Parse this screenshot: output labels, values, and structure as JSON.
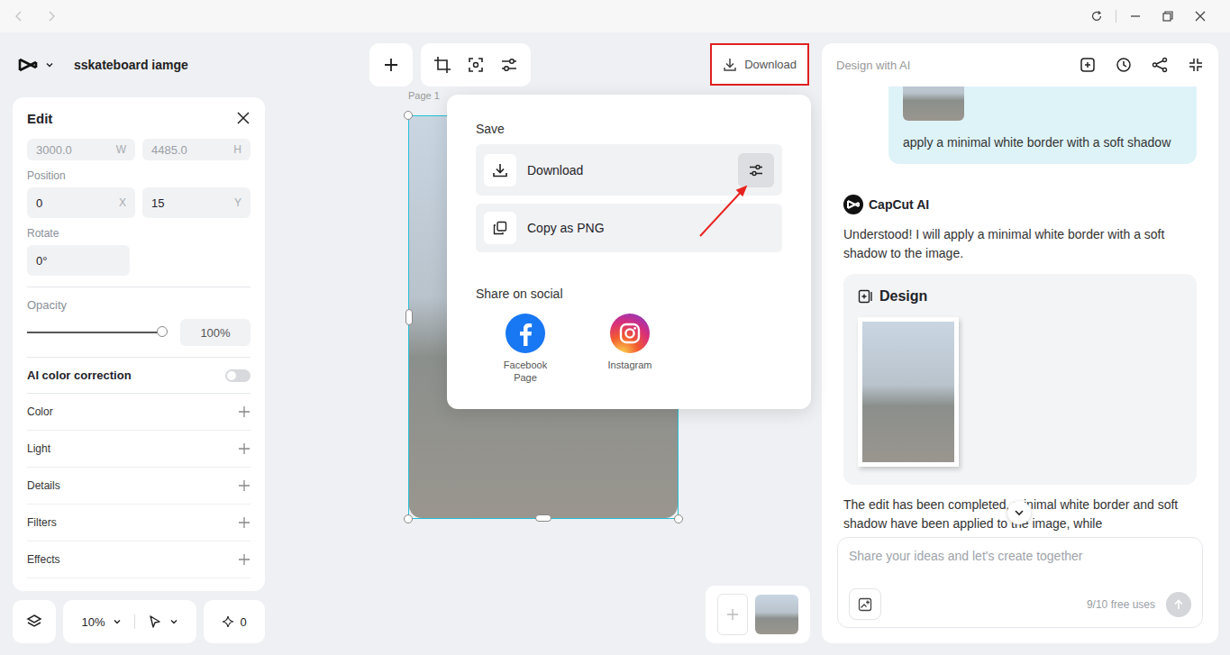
{
  "project": {
    "name": "sskateboard iamge"
  },
  "edit_panel": {
    "title": "Edit",
    "size": [
      {
        "value": "3000.0",
        "axis": "W"
      },
      {
        "value": "4485.0",
        "axis": "H"
      }
    ],
    "position_label": "Position",
    "position": [
      {
        "value": "0",
        "axis": "X"
      },
      {
        "value": "15",
        "axis": "Y"
      }
    ],
    "rotate_label": "Rotate",
    "rotate": "0°",
    "opacity_label": "Opacity",
    "opacity": {
      "level": 1,
      "reading": "100%"
    },
    "ai_color": {
      "label": "AI color correction",
      "on": false
    },
    "sections": [
      "Color",
      "Light",
      "Details",
      "Filters",
      "Effects"
    ]
  },
  "bottom_bar": {
    "zoom": "10%",
    "ai_count": "0"
  },
  "canvas": {
    "page_label": "Page 1"
  },
  "toolbar": {
    "download": {
      "label": "Download",
      "annotated": true
    }
  },
  "download_menu": {
    "save_label": "Save",
    "items": [
      {
        "label": "Download",
        "kind": "download",
        "annotated": true
      },
      {
        "label": "Copy as PNG",
        "kind": "copy",
        "annotated": false
      }
    ],
    "share_label": "Share on social",
    "social": [
      {
        "label": "Facebook Page",
        "kind": "facebook"
      },
      {
        "label": "Instagram",
        "kind": "instagram"
      }
    ]
  },
  "ai_panel": {
    "title": "Design with AI",
    "messages": [
      {
        "kind": "user",
        "text": "apply a minimal white border with a soft shadow"
      },
      {
        "kind": "ai",
        "author": "CapCut AI",
        "text": "Understood! I will apply a minimal white border with a soft shadow to the image.",
        "card": "Design"
      },
      {
        "kind": "ai-text",
        "text": "The edit has been completed, minimal white border and soft shadow have been applied to the image, while"
      }
    ],
    "input": {
      "placeholder": "Share your ideas and let's create together",
      "usage": "9/10 free uses"
    }
  }
}
